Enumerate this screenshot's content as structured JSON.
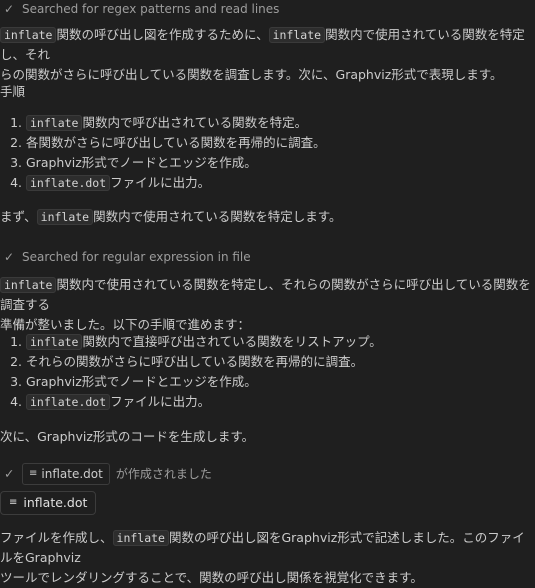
{
  "status1": "Searched for regex patterns and read lines",
  "intro": {
    "code1": "inflate",
    "t1": "関数の呼び出し図を作成するために、",
    "code2": "inflate",
    "t2": "関数内で使用されている関数を特定し、それ",
    "t3": "らの関数がさらに呼び出している関数を調査します。次に、Graphviz形式で表現します。"
  },
  "steps_heading": "手順",
  "steps1": [
    {
      "code": "inflate",
      "text": "関数内で呼び出されている関数を特定。"
    },
    {
      "code": "",
      "text": "各関数がさらに呼び出している関数を再帰的に調査。"
    },
    {
      "code": "",
      "text": "Graphviz形式でノードとエッジを作成。"
    },
    {
      "code": "inflate.dot",
      "text": "ファイルに出力。"
    }
  ],
  "first_line": {
    "t1": "まず、",
    "code": "inflate",
    "t2": "関数内で使用されている関数を特定します。"
  },
  "status2": "Searched for regular expression in file",
  "second_para": {
    "code": "inflate",
    "t1": "関数内で使用されている関数を特定し、それらの関数がさらに呼び出している関数を調査する",
    "t2": "準備が整いました。以下の手順で進めます："
  },
  "steps2": [
    {
      "code": "inflate",
      "text": "関数内で直接呼び出されている関数をリストアップ。"
    },
    {
      "code": "",
      "text": "それらの関数がさらに呼び出している関数を再帰的に調査。"
    },
    {
      "code": "",
      "text": "Graphviz形式でノードとエッジを作成。"
    },
    {
      "code": "inflate.dot",
      "text": "ファイルに出力。"
    }
  ],
  "next_line": "次に、Graphviz形式のコードを生成します。",
  "created": {
    "file": "inflate.dot",
    "text": "が作成されました"
  },
  "file_pill": "inflate.dot",
  "final": {
    "t1": "ファイルを作成し、",
    "code": "inflate",
    "t2": "関数の呼び出し図をGraphviz形式で記述しました。このファイルをGraphviz",
    "t3": "ツールでレンダリングすることで、関数の呼び出し関係を視覚化できます。"
  }
}
